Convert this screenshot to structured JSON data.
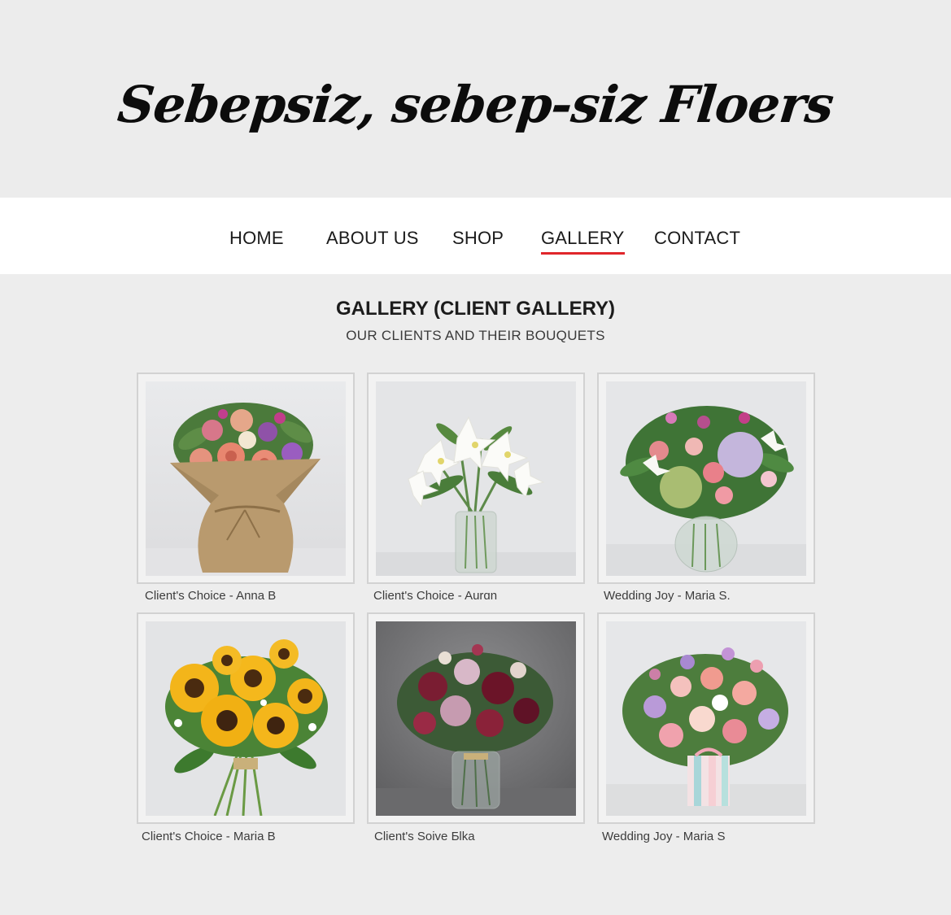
{
  "site": {
    "title": "Sebepsiz, sebep-siz Floers"
  },
  "nav": {
    "items": [
      {
        "label": "HOME"
      },
      {
        "label": "ABOUT US"
      },
      {
        "label": "SHOP"
      },
      {
        "label": "GALLERY"
      },
      {
        "label": "CONTACT"
      }
    ],
    "active": "GALLERY",
    "accent_color": "#e0262b"
  },
  "gallery": {
    "title": "GALLERY (CLIENT GALLERY)",
    "subtitle": "OUR CLIENTS AND THEIR BOUQUETS",
    "items": [
      {
        "caption": "Client's Choice - Anna B",
        "image": "burlap-wrapped-rose-bouquet"
      },
      {
        "caption": "Client's Choice - Aurɑn",
        "image": "white-lilies-in-glass-vase"
      },
      {
        "caption": "Wedding Joy - Maria S.",
        "image": "mixed-hydrangea-rose-bouquet-vase"
      },
      {
        "caption": "Client's Choice - Maria B",
        "image": "sunflower-bouquet"
      },
      {
        "caption": "Client's Soive Ƃlka",
        "image": "burgundy-dahlia-rose-bouquet-vase"
      },
      {
        "caption": "Wedding Joy - Maria S",
        "image": "pastel-bouquet-in-striped-box"
      }
    ]
  }
}
